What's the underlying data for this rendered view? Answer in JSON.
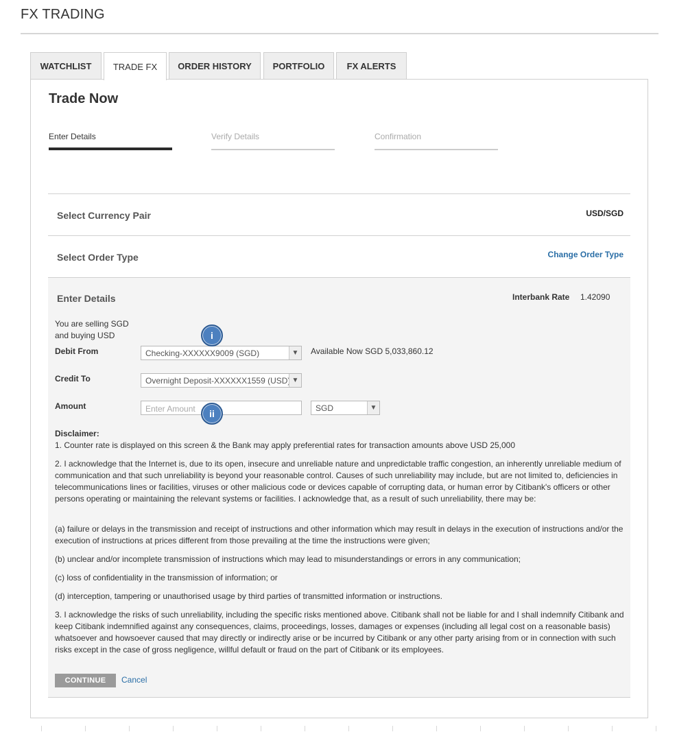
{
  "app": {
    "title": "FX TRADING"
  },
  "tabs": [
    {
      "label": "WATCHLIST"
    },
    {
      "label": "TRADE FX"
    },
    {
      "label": "ORDER HISTORY"
    },
    {
      "label": "PORTFOLIO"
    },
    {
      "label": "FX ALERTS"
    }
  ],
  "active_tab": "TRADE FX",
  "panel": {
    "title": "Trade Now",
    "steps": [
      {
        "label": "Enter Details",
        "state": "active"
      },
      {
        "label": "Verify Details",
        "state": "inactive"
      },
      {
        "label": "Confirmation",
        "state": "inactive"
      }
    ]
  },
  "currency_pair": {
    "label": "Select Currency Pair",
    "value": "USD/SGD"
  },
  "order_type": {
    "label": "Select Order Type",
    "link": "Change Order Type"
  },
  "details": {
    "label": "Enter Details",
    "interbank_label": "Interbank Rate",
    "interbank_value": "1.42090",
    "selling_line1": "You are selling SGD",
    "selling_line2": "and buying USD",
    "debit_label": "Debit From",
    "debit_value": "Checking-XXXXXX9009 (SGD)",
    "available": "Available Now SGD 5,033,860.12",
    "credit_label": "Credit To",
    "credit_value": "Overnight Deposit-XXXXXX1559 (USD)",
    "amount_label": "Amount",
    "amount_value": "",
    "amount_placeholder": "Enter Amount",
    "currency_value": "SGD",
    "badge_i": "i",
    "badge_ii": "ii"
  },
  "disclaimer": {
    "heading": "Disclaimer:",
    "p1": "1. Counter rate is displayed on this screen & the Bank may apply preferential rates for transaction amounts above USD 25,000",
    "p2": "2. I acknowledge that the Internet is, due to its open, insecure and unreliable nature and unpredictable traffic congestion, an inherently unreliable medium of communication and that such unreliability is beyond your reasonable control. Causes of such unreliability may include, but are not limited to, deficiencies in telecommunications lines or facilities, viruses or other malicious code or devices capable of corrupting data, or human error by Citibank's officers or other persons operating or maintaining the relevant systems or facilities. I acknowledge that, as a result of such unreliability, there may be:",
    "pa": "(a) failure or delays in the transmission and receipt of instructions and other information which may result in delays in the execution of instructions and/or the execution of instructions at prices different from those prevailing at the time the instructions were given;",
    "pb": "(b) unclear and/or incomplete transmission of instructions which may lead to misunderstandings or errors in any communication;",
    "pc": "(c) loss of confidentiality in the transmission of information; or",
    "pd": "(d) interception, tampering or unauthorised usage by third parties of transmitted information or instructions.",
    "p3": "3. I acknowledge the risks of such unreliability, including the specific risks mentioned above. Citibank shall not be liable for and I shall indemnify Citibank and keep Citibank indemnified against any consequences, claims, proceedings, losses, damages or expenses (including all legal cost on a reasonable basis) whatsoever and howsoever caused that may directly or indirectly arise or be incurred by Citibank or any other party arising from or in connection with such risks except in the case of gross negligence, willful default or fraud on the part of Citibank or its employees."
  },
  "actions": {
    "continue": "CONTINUE",
    "cancel": "Cancel"
  },
  "icons": {
    "dropdown": "caret-down-icon"
  },
  "colors": {
    "link": "#2a6ea6",
    "badge": "#4c80bf",
    "button": "#9a9a9a"
  }
}
